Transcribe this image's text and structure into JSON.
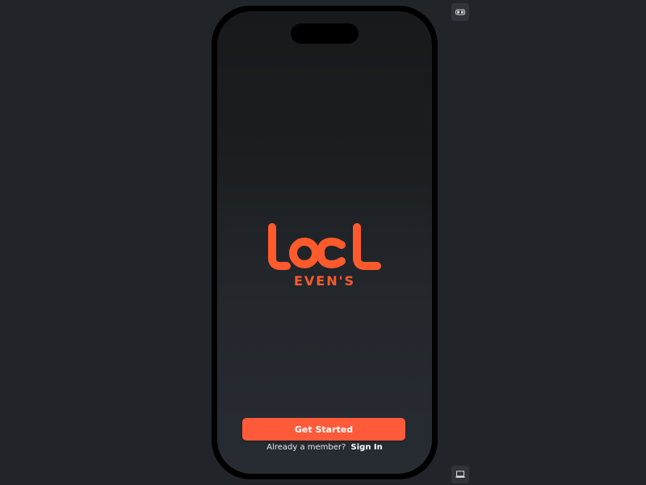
{
  "brand": {
    "logo_text": "LOCL",
    "logo_subtext": "EVEN'S",
    "accent_color": "#ff5a2c"
  },
  "actions": {
    "get_started_label": "Get Started",
    "already_member_text": "Already a member?",
    "sign_in_label": "Sign In"
  },
  "toolbar": {
    "top_icon": "toggle-icon",
    "bottom_icon": "laptop-icon"
  }
}
